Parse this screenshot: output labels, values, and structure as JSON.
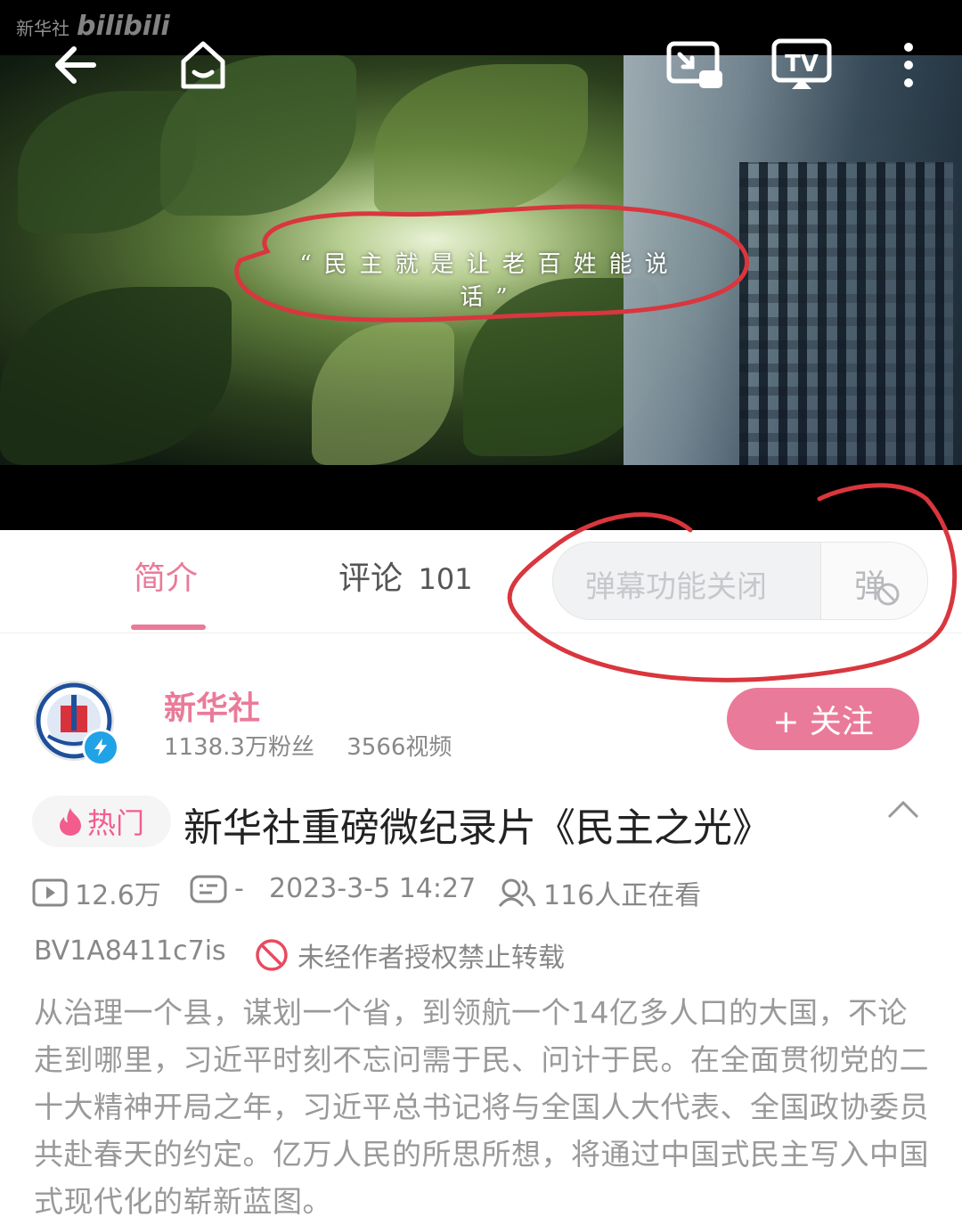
{
  "watermark": {
    "left": "新华社",
    "right": "bilibili"
  },
  "video": {
    "subtitle": "“民主就是让老百姓能说话”"
  },
  "tabs": [
    {
      "label": "简介"
    },
    {
      "label": "评论",
      "count": "101"
    }
  ],
  "danmaku": {
    "placeholder": "弹幕功能关闭",
    "toggle_label": "弹"
  },
  "uploader": {
    "name": "新华社",
    "fans": "1138.3万粉丝",
    "videos": "3566视频",
    "follow_label": "+ 关注"
  },
  "video_info": {
    "badge": "热门",
    "title": "新华社重磅微纪录片《民主之光》",
    "plays": "12.6万",
    "danmaku_count": "-",
    "date": "2023-3-5 14:27",
    "watching": "116人正在看",
    "bvid": "BV1A8411c7is",
    "copyright": "未经作者授权禁止转载",
    "description": "从治理一个县，谋划一个省，到领航一个14亿多人口的大国，不论走到哪里，习近平时刻不忘问需于民、问计于民。在全面贯彻党的二十大精神开局之年，习近平总书记将与全国人大代表、全国政协委员共赴春天的约定。亿万人民的所思所想，将通过中国式民主写入中国式现代化的崭新蓝图。"
  },
  "colors": {
    "accent": "#ea7a99",
    "annotation": "#d9363e"
  },
  "icons": [
    "back-arrow-icon",
    "home-icon",
    "pip-icon",
    "tv-cast-icon",
    "more-icon",
    "verified-icon",
    "fire-icon",
    "chevron-up-icon",
    "play-count-icon",
    "danmaku-count-icon",
    "watching-icon",
    "forbid-icon"
  ]
}
